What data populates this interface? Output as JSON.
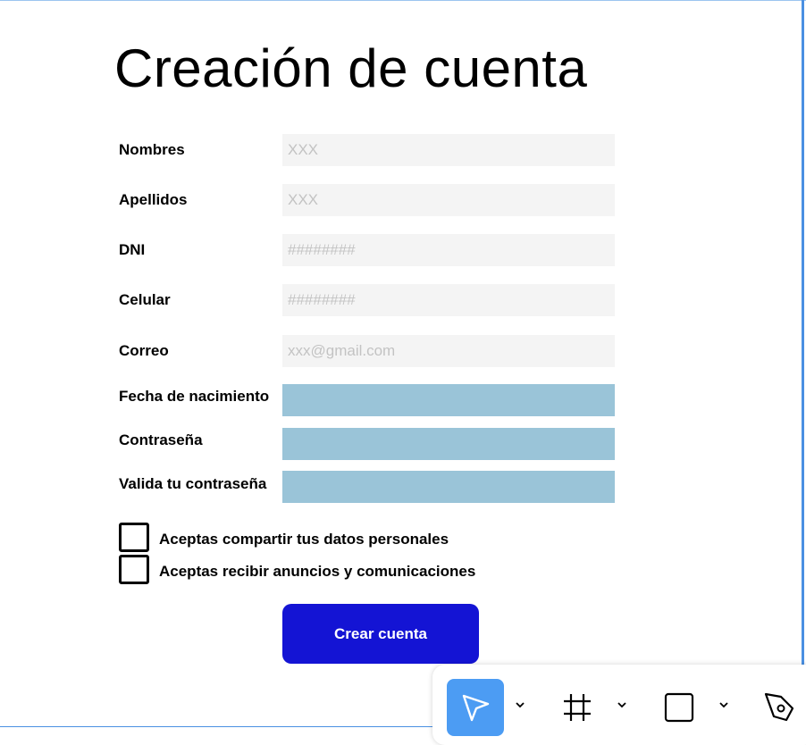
{
  "form": {
    "title": "Creación de cuenta",
    "fields": [
      {
        "label": "Nombres",
        "placeholder": "XXX"
      },
      {
        "label": "Apellidos",
        "placeholder": "XXX"
      },
      {
        "label": "DNI",
        "placeholder": "########"
      },
      {
        "label": "Celular",
        "placeholder": "########"
      },
      {
        "label": "Correo",
        "placeholder": "xxx@gmail.com"
      },
      {
        "label": "Fecha de nacimiento",
        "placeholder": ""
      },
      {
        "label": "Contraseña",
        "placeholder": ""
      },
      {
        "label": "Valida tu contraseña",
        "placeholder": ""
      }
    ],
    "checkboxes": [
      {
        "label": "Aceptas compartir tus datos personales",
        "checked": false
      },
      {
        "label": "Aceptas recibir anuncios y comunicaciones",
        "checked": false
      }
    ],
    "submit_label": "Crear cuenta"
  },
  "colors": {
    "input_bg": "#f4f4f4",
    "input_blue": "#9ac4d8",
    "button": "#1414d4",
    "toolbar_active": "#4c9cf3",
    "frame_border": "#4a90e2"
  },
  "toolbar": {
    "tools": [
      {
        "icon": "pointer-arrow-icon",
        "active": true
      },
      {
        "icon": "frame-grid-icon",
        "active": false
      },
      {
        "icon": "rectangle-icon",
        "active": false
      },
      {
        "icon": "pen-tool-icon",
        "active": false
      }
    ]
  }
}
